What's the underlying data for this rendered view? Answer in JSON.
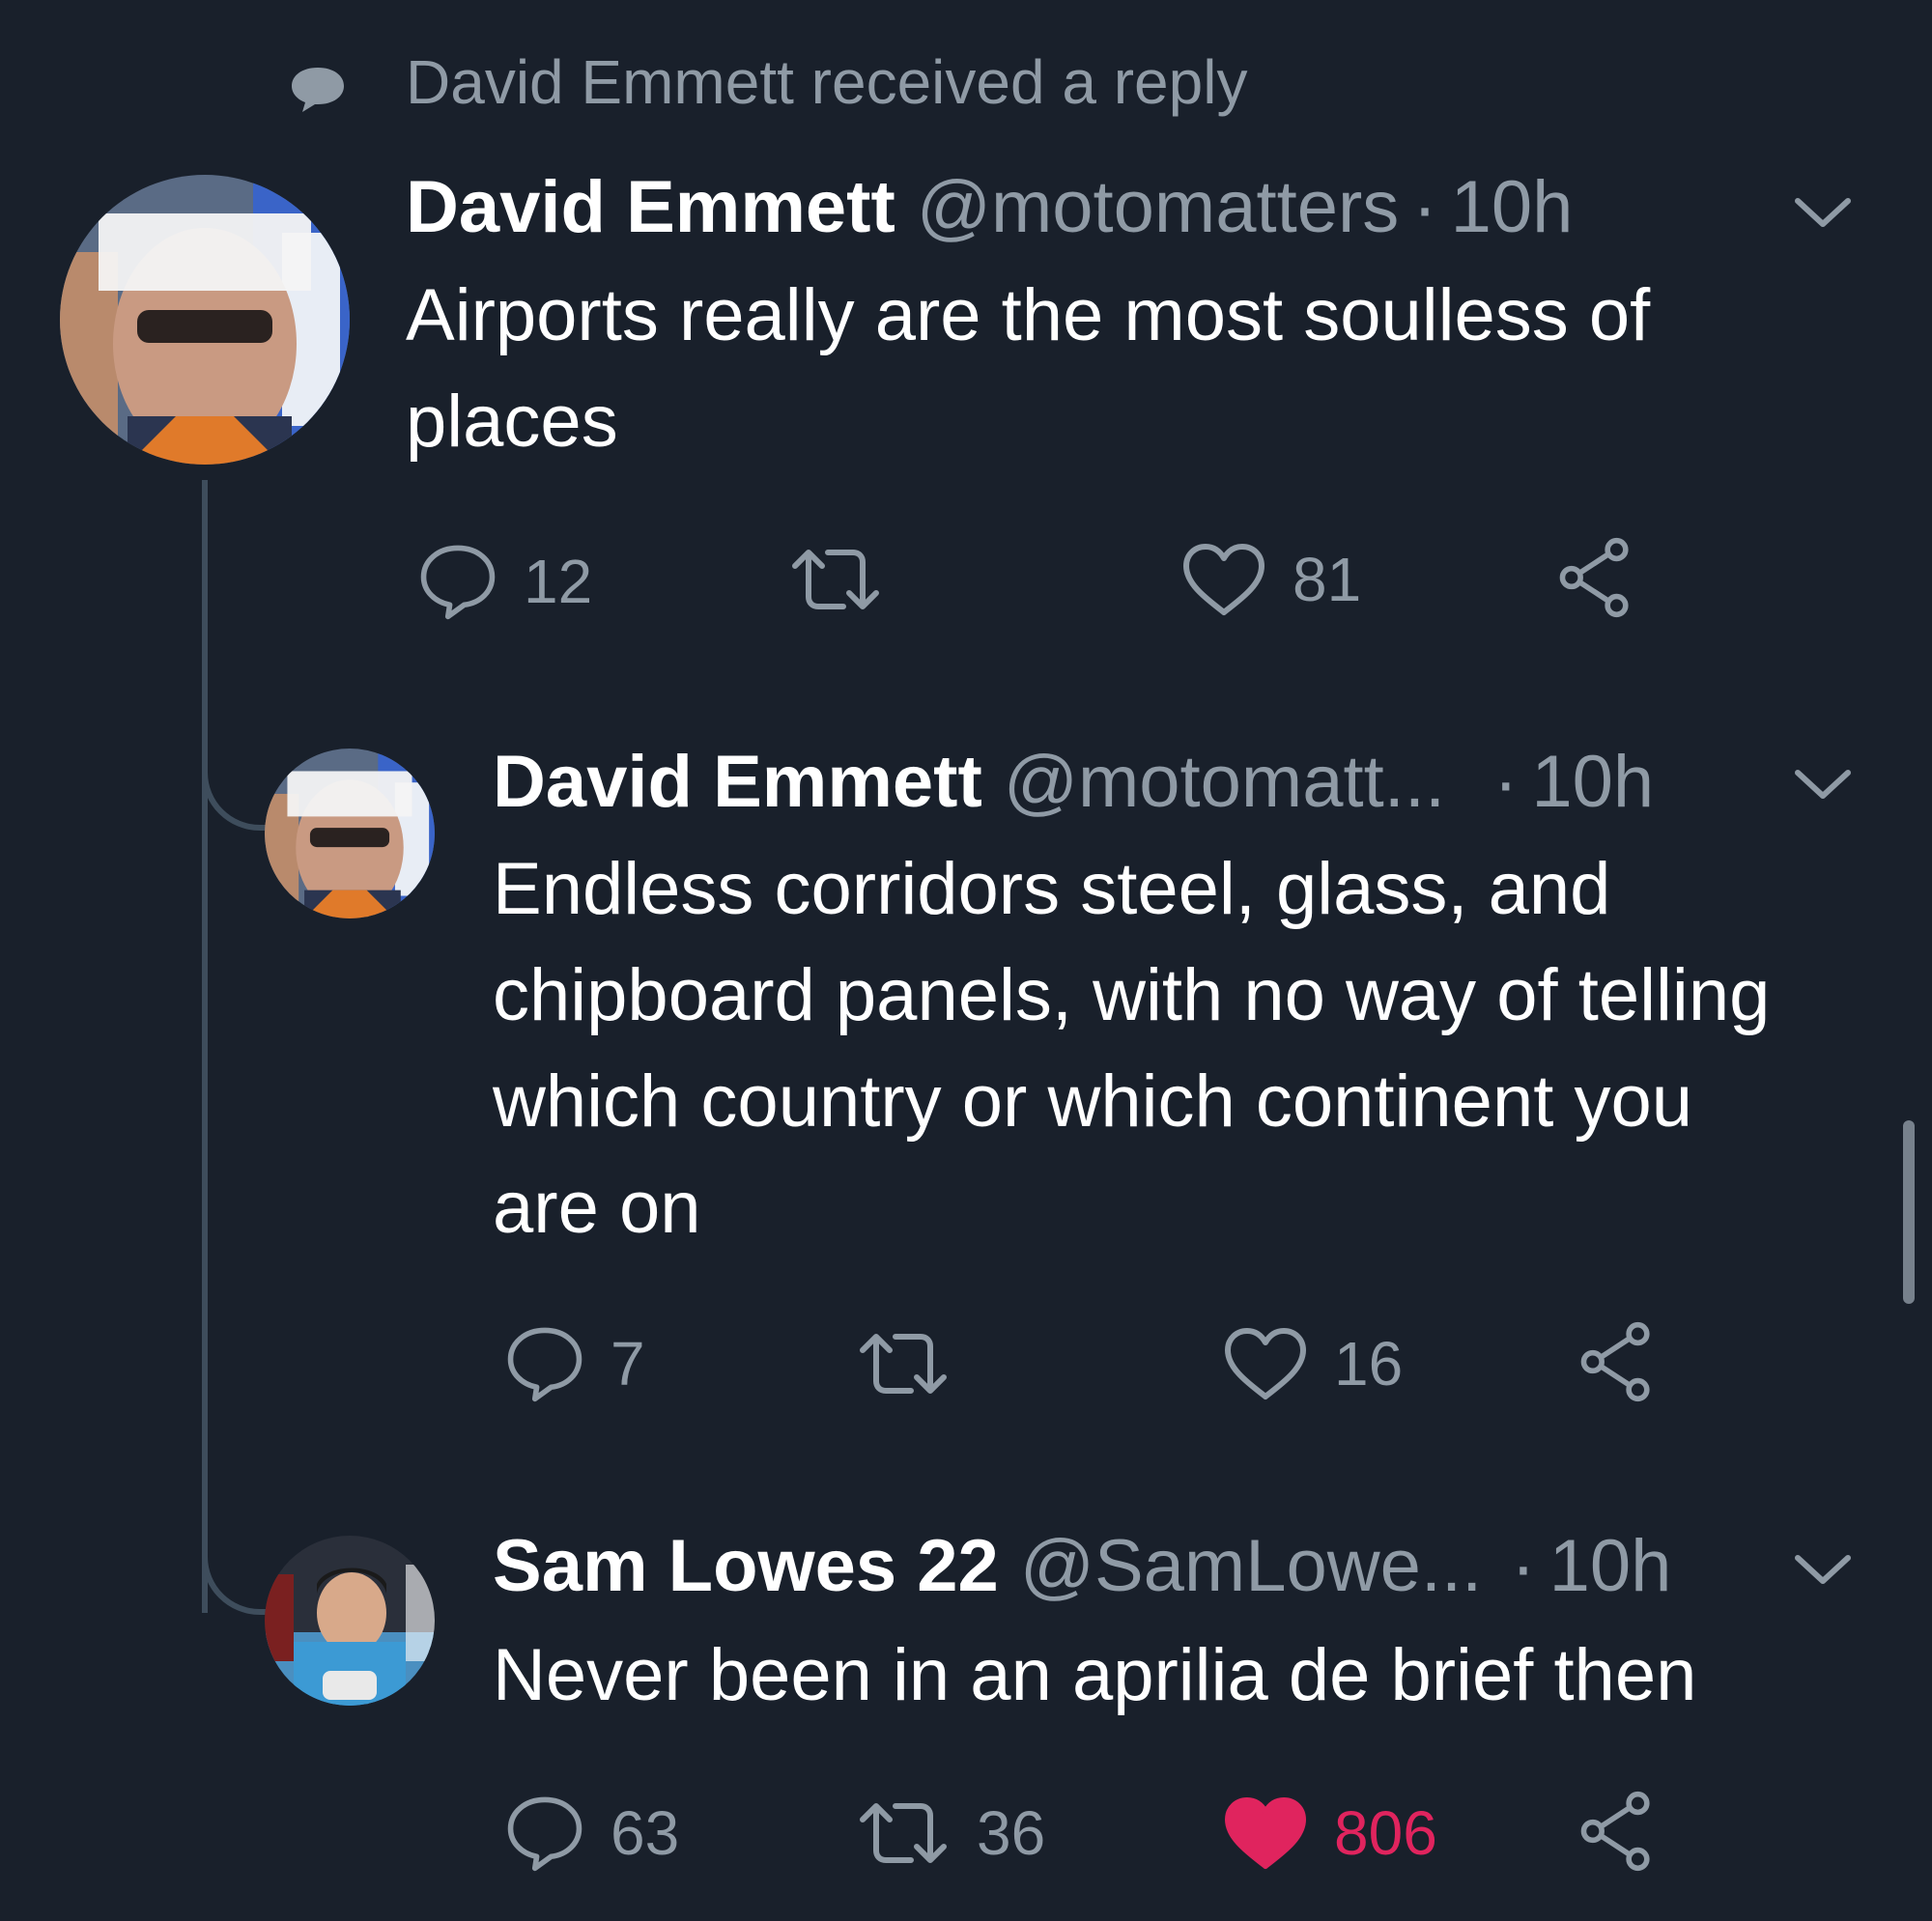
{
  "context": {
    "icon": "speech-bubble-icon",
    "text": "David Emmett received a reply"
  },
  "tweets": [
    {
      "name": "David Emmett",
      "handle": "@motomatters",
      "separator": "·",
      "time": "10h",
      "text": "Airports really are the most soulless of places",
      "actions": {
        "reply": "12",
        "retweet": "",
        "like": "81"
      }
    },
    {
      "name": "David Emmett",
      "handle": "@motomatt...",
      "separator": "·",
      "time": "10h",
      "text": "Endless corridors steel, glass, and chipboard panels, with no way of telling which country or which continent you are on",
      "actions": {
        "reply": "7",
        "retweet": "",
        "like": "16"
      }
    },
    {
      "name": "Sam Lowes 22",
      "handle": "@SamLowe...",
      "separator": "·",
      "time": "10h",
      "text": "Never been in an aprilia de brief then",
      "actions": {
        "reply": "63",
        "retweet": "36",
        "like": "806",
        "liked": true
      }
    }
  ],
  "colors": {
    "background": "#19202b",
    "secondary_text": "#8f9aa5",
    "like_active": "#e0245e"
  }
}
